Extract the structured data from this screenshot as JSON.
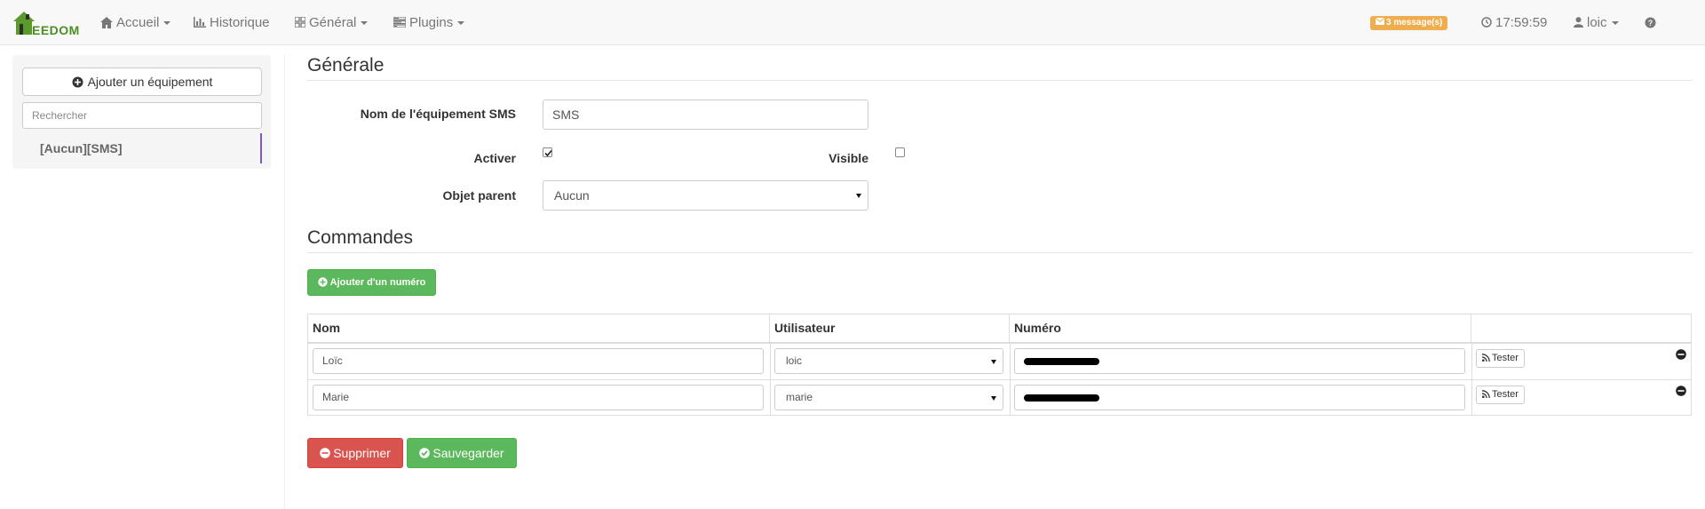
{
  "navbar": {
    "logo_text": "EEDOM",
    "menu": [
      {
        "label": "Accueil",
        "icon": "home-icon",
        "has_caret": true
      },
      {
        "label": "Historique",
        "icon": "bar-chart-icon",
        "has_caret": false
      },
      {
        "label": "Général",
        "icon": "grid-icon",
        "has_caret": true
      },
      {
        "label": "Plugins",
        "icon": "tasks-icon",
        "has_caret": true
      }
    ],
    "messages_label": "3 message(s)",
    "time": "17:59:59",
    "user": "loic",
    "help_icon": "question-circle-icon"
  },
  "sidebar": {
    "add_button": "Ajouter un équipement",
    "search_placeholder": "Rechercher",
    "items": [
      {
        "label": "[Aucun][SMS]"
      }
    ]
  },
  "general": {
    "title": "Générale",
    "name_label": "Nom de l'équipement SMS",
    "name_value": "SMS",
    "enable_label": "Activer",
    "enable_checked": true,
    "visible_label": "Visible",
    "visible_checked": false,
    "parent_label": "Objet parent",
    "parent_value": "Aucun"
  },
  "commands": {
    "title": "Commandes",
    "add_number_button": "Ajouter d'un numéro",
    "columns": [
      "Nom",
      "Utilisateur",
      "Numéro",
      ""
    ],
    "rows": [
      {
        "nom": "Loïc",
        "utilisateur": "loic",
        "numero_redacted": true,
        "test_label": "Tester"
      },
      {
        "nom": "Marie",
        "utilisateur": "marie",
        "numero_redacted": true,
        "test_label": "Tester"
      }
    ]
  },
  "actions": {
    "delete_label": "Supprimer",
    "save_label": "Sauvegarder"
  },
  "colors": {
    "success": "#5cb85c",
    "danger": "#d9534f",
    "warning": "#f0ad4e",
    "active_item_border": "#7e57c2"
  }
}
